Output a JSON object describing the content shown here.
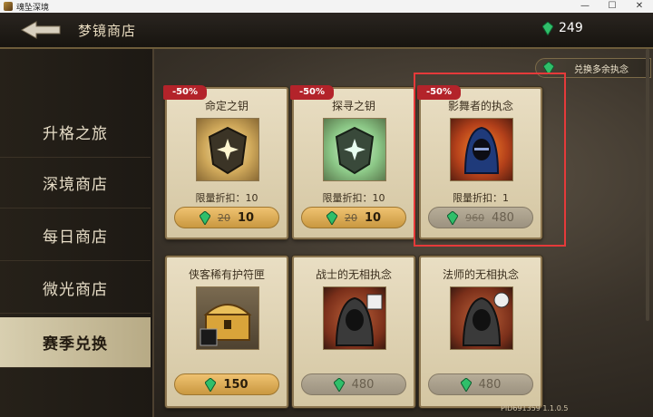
{
  "window": {
    "title": "魂坠深境",
    "minimize": "—",
    "maximize": "☐",
    "close": "✕"
  },
  "header": {
    "title": "梦镜商店",
    "currency_amount": "249"
  },
  "sidebar": {
    "items": [
      {
        "label": "升格之旅",
        "active": false
      },
      {
        "label": "深境商店",
        "active": false
      },
      {
        "label": "每日商店",
        "active": false
      },
      {
        "label": "微光商店",
        "active": false
      },
      {
        "label": "赛季兑换",
        "active": true
      }
    ]
  },
  "exchange_button": {
    "label": "兑换多余执念"
  },
  "cards": [
    {
      "name": "命定之钥",
      "discount": "-50%",
      "limit": "限量折扣：10",
      "old_price": "20",
      "price": "10",
      "state": "available",
      "icon": "shield-key-gold-icon"
    },
    {
      "name": "探寻之钥",
      "discount": "-50%",
      "limit": "限量折扣：10",
      "old_price": "20",
      "price": "10",
      "state": "available",
      "icon": "shield-key-green-icon"
    },
    {
      "name": "影舞者的执念",
      "discount": "-50%",
      "limit": "限量折扣：1",
      "old_price": "960",
      "price": "480",
      "state": "soldout",
      "icon": "shadow-dancer-icon"
    },
    {
      "name": "侠客稀有护符匣",
      "price": "150",
      "state": "available",
      "icon": "treasure-chest-icon"
    },
    {
      "name": "战士的无相执念",
      "price": "480",
      "state": "soldout",
      "icon": "warrior-hooded-icon"
    },
    {
      "name": "法师的无相执念",
      "price": "480",
      "state": "soldout",
      "icon": "mage-hooded-icon"
    }
  ],
  "footer": {
    "pid": "PID691359  1.1.0.5"
  },
  "colors": {
    "accent_gold": "#c99840",
    "discount_red": "#b3232a",
    "highlight_red": "#e53a3a",
    "gem_green": "#2fbf6a"
  }
}
